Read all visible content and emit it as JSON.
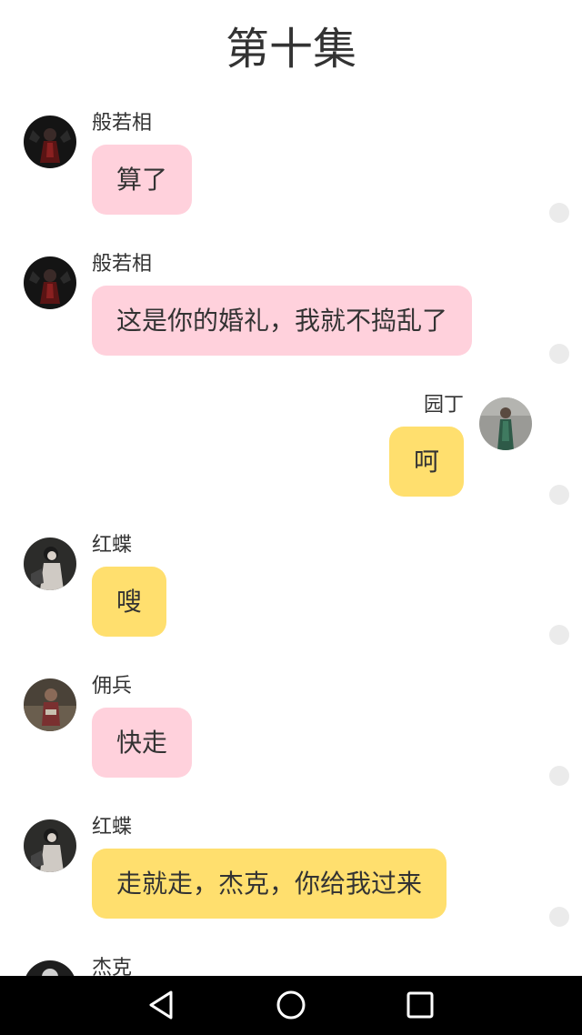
{
  "title": "第十集",
  "messages": [
    {
      "name": "般若相",
      "text": "算了",
      "side": "left",
      "color": "pink",
      "avatar_icon": "character-avatar-hannya"
    },
    {
      "name": "般若相",
      "text": "这是你的婚礼，我就不捣乱了",
      "side": "left",
      "color": "pink",
      "avatar_icon": "character-avatar-hannya"
    },
    {
      "name": "园丁",
      "text": "呵",
      "side": "right",
      "color": "yellow",
      "avatar_icon": "character-avatar-gardener"
    },
    {
      "name": "红蝶",
      "text": "嗖",
      "side": "left",
      "color": "yellow",
      "avatar_icon": "character-avatar-geisha"
    },
    {
      "name": "佣兵",
      "text": "快走",
      "side": "left",
      "color": "pink",
      "avatar_icon": "character-avatar-mercenary"
    },
    {
      "name": "红蝶",
      "text": "走就走，杰克，你给我过来",
      "side": "left",
      "color": "yellow",
      "avatar_icon": "character-avatar-geisha"
    },
    {
      "name": "杰克",
      "text": "",
      "side": "left",
      "color": "pink",
      "avatar_icon": "character-avatar-jack"
    }
  ],
  "colors": {
    "pink_bubble": "#ffd1dc",
    "yellow_bubble": "#ffdf6e",
    "navbar": "#000000"
  },
  "navbar": {
    "back_icon": "back-triangle-icon",
    "home_icon": "home-circle-icon",
    "recent_icon": "recent-apps-square-icon"
  }
}
